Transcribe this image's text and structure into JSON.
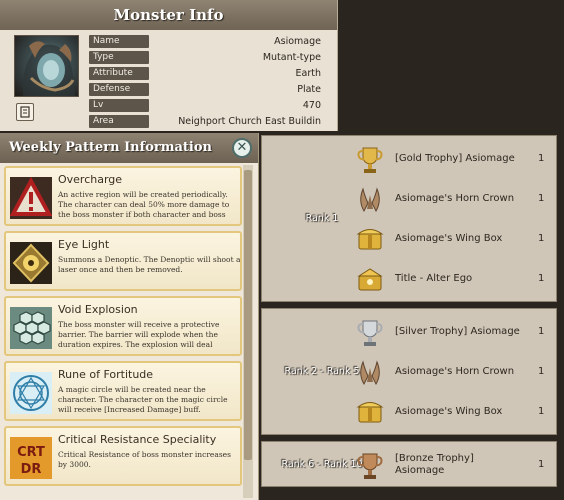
{
  "monster_info": {
    "title": "Monster Info",
    "rows": [
      {
        "label": "Name",
        "value": "Asiomage"
      },
      {
        "label": "Type",
        "value": "Mutant-type"
      },
      {
        "label": "Attribute",
        "value": "Earth"
      },
      {
        "label": "Defense type",
        "value": "Plate"
      },
      {
        "label": "Lv",
        "value": "470"
      },
      {
        "label": "Area",
        "value": "Neighport Church East Buildin"
      }
    ]
  },
  "weekly_patterns": {
    "title": "Weekly Pattern Information",
    "close_label": "✕",
    "items": [
      {
        "title": "Overcharge",
        "description": "An active region will be created periodically. The character can deal 50% more damage to the boss monster if both character and boss",
        "icon": "warning-triangle-icon"
      },
      {
        "title": "Eye Light",
        "description": "Summons a Denoptic. The Denoptic will shoot a laser once and then be removed.",
        "icon": "denoptic-eye-icon"
      },
      {
        "title": "Void Explosion",
        "description": "The boss monster will receive a protective barrier. The barrier will explode when the duration expires. The explosion will deal",
        "icon": "hexagon-barrier-icon"
      },
      {
        "title": "Rune of Fortitude",
        "description": "A magic circle will be created near the character. The character on the magic circle will receive [Increased Damage] buff.",
        "icon": "magic-circle-icon"
      },
      {
        "title": "Critical Resistance Speciality",
        "description": "Critical Resistance of boss monster increases by 3000.",
        "icon": "crt-dr-icon",
        "icon_text": [
          "CRT",
          "DR"
        ]
      }
    ]
  },
  "rewards": {
    "groups": [
      {
        "rank": "Rank 1",
        "items": [
          {
            "name": "[Gold Trophy] Asiomage",
            "qty": "1",
            "icon": "gold-trophy-icon"
          },
          {
            "name": "Asiomage's Horn Crown",
            "qty": "1",
            "icon": "horn-crown-icon"
          },
          {
            "name": "Asiomage's Wing Box",
            "qty": "1",
            "icon": "wing-box-icon"
          },
          {
            "name": "Title - Alter Ego",
            "qty": "1",
            "icon": "title-box-icon"
          }
        ]
      },
      {
        "rank": "Rank 2 - Rank 5",
        "items": [
          {
            "name": "[Silver Trophy] Asiomage",
            "qty": "1",
            "icon": "silver-trophy-icon"
          },
          {
            "name": "Asiomage's Horn Crown",
            "qty": "1",
            "icon": "horn-crown-icon"
          },
          {
            "name": "Asiomage's Wing Box",
            "qty": "1",
            "icon": "wing-box-icon"
          }
        ]
      },
      {
        "rank": "Rank 6 - Rank 10",
        "items": [
          {
            "name": "[Bronze Trophy] Asiomage",
            "qty": "1",
            "icon": "bronze-trophy-icon"
          }
        ]
      }
    ]
  },
  "colors": {
    "header": "#7d7262",
    "gold_border": "#e2c77c",
    "panel_bg": "#cfc6b7"
  }
}
